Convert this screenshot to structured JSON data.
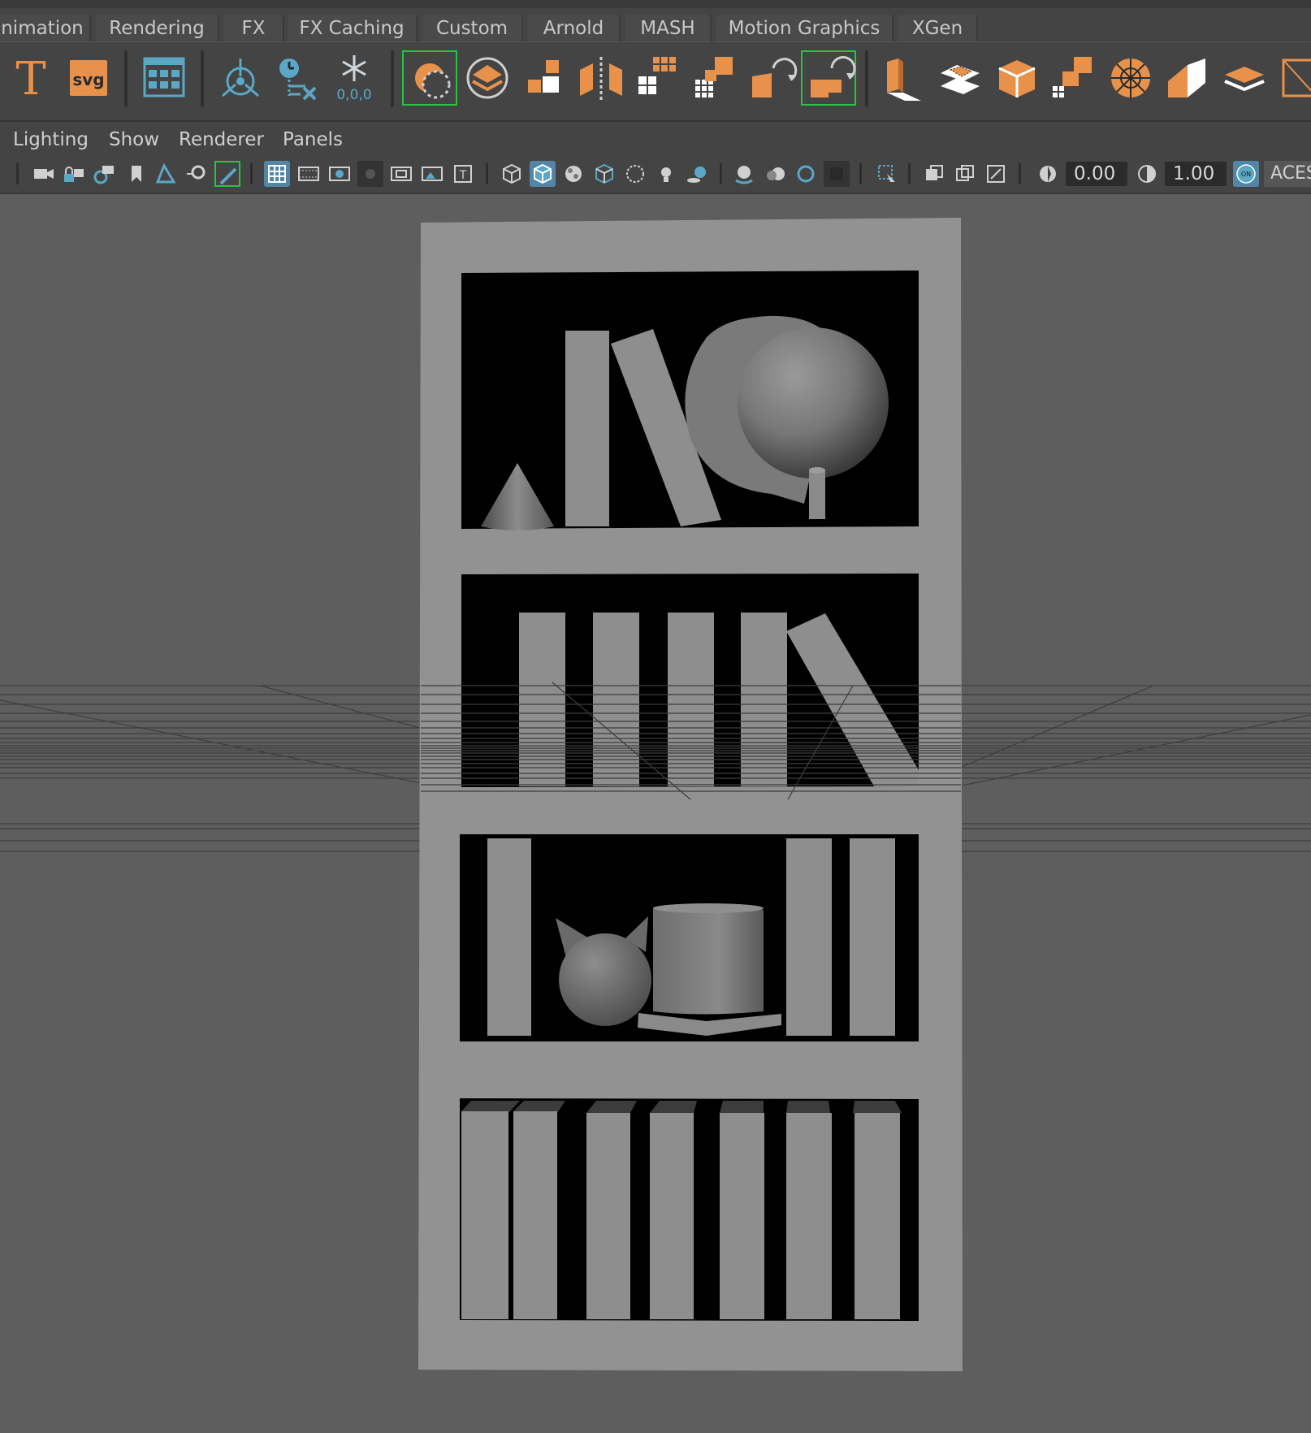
{
  "shelf_tabs": [
    "nimation",
    "Rendering",
    "FX",
    "FX Caching",
    "Custom",
    "Arnold",
    "MASH",
    "Motion Graphics",
    "XGen"
  ],
  "shelf_icons": {
    "text_tool": "T",
    "svg_tool": "svg",
    "origin_label": "0,0,0"
  },
  "panel_menu": [
    "Lighting",
    "Show",
    "Renderer",
    "Panels"
  ],
  "panel_toolbar": {
    "exposure_value": "0.00",
    "gamma_value": "1.00",
    "color_mgmt_toggle": "ON",
    "color_space": "ACES"
  },
  "colors": {
    "accent_orange": "#e8914a",
    "accent_blue": "#5aa7c6",
    "active_blue": "#5285a6",
    "highlight_green": "#27c443",
    "bookcase_gray": "#929292"
  }
}
